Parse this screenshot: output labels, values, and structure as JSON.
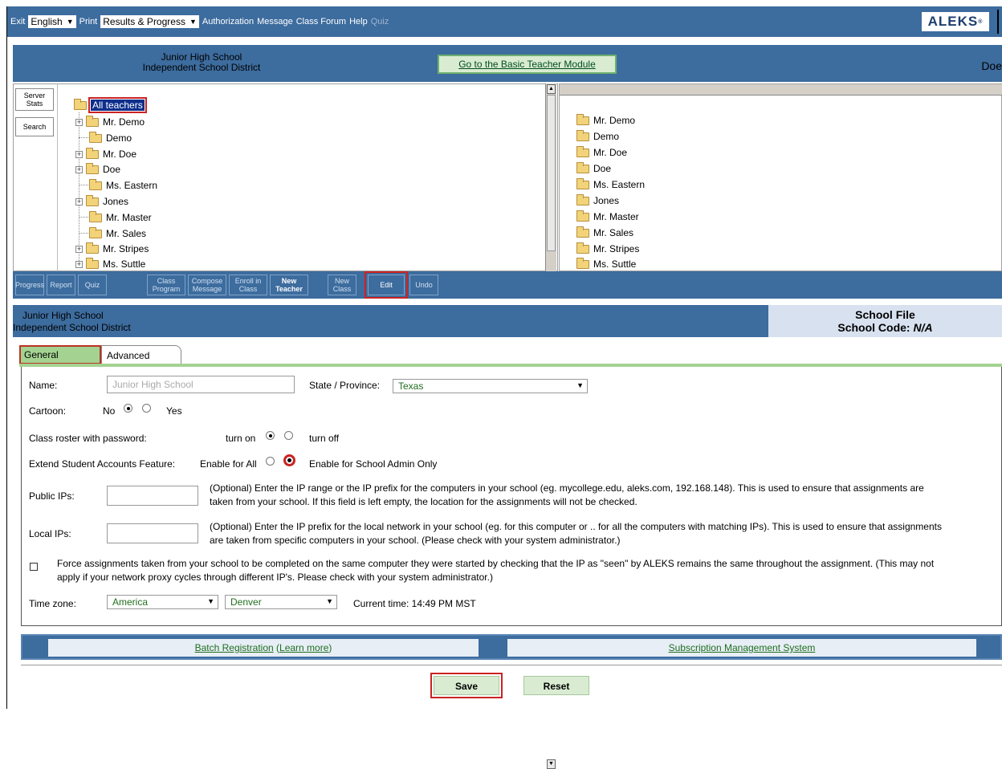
{
  "topbar": {
    "exit": "Exit",
    "language": "English",
    "print": "Print",
    "results": "Results & Progress",
    "authorization": "Authorization",
    "message": "Message",
    "forum": "Class Forum",
    "help": "Help",
    "quiz": "Quiz",
    "logo": "ALEKS"
  },
  "header": {
    "school_line1": "Junior High School",
    "school_line2": "Independent School District",
    "basic_module": "Go to the Basic Teacher Module",
    "user": "Doe"
  },
  "side": {
    "server_stats": "Server Stats",
    "search": "Search"
  },
  "tree": {
    "root": "All teachers",
    "items": [
      "Mr. Demo",
      "Demo",
      "Mr. Doe",
      "Doe",
      "Ms. Eastern",
      "Jones",
      "Mr. Master",
      "Mr. Sales",
      "Mr. Stripes",
      "Ms. Suttle"
    ]
  },
  "list": {
    "items": [
      "Mr. Demo",
      "Demo",
      "Mr. Doe",
      "Doe",
      "Ms. Eastern",
      "Jones",
      "Mr. Master",
      "Mr. Sales",
      "Mr. Stripes",
      "Ms. Suttle"
    ]
  },
  "toolbar": {
    "progress": "Progress",
    "report": "Report",
    "quiz": "Quiz",
    "class_program": "Class Program",
    "compose_message": "Compose Message",
    "enroll_in_class": "Enroll in Class",
    "new_teacher": "New Teacher",
    "new_class": "New Class",
    "edit": "Edit",
    "undo": "Undo"
  },
  "info": {
    "school_line1": "Junior High School",
    "school_line2": "Independent School District",
    "file_title": "School File",
    "school_code_label": "School Code: ",
    "school_code": "N/A"
  },
  "tabs": {
    "general": "General",
    "advanced": "Advanced"
  },
  "form": {
    "name_label": "Name:",
    "name_placeholder": "Junior High School",
    "state_label": "State / Province:",
    "state_value": "Texas",
    "cartoon_label": "Cartoon:",
    "cartoon_no": "No",
    "cartoon_yes": "Yes",
    "roster_label": "Class roster with password:",
    "roster_on": "turn on",
    "roster_off": "turn off",
    "extend_label": "Extend Student Accounts Feature:",
    "extend_all": "Enable for All",
    "extend_admin": "Enable for School Admin Only",
    "public_label": "Public IPs:",
    "public_help_1": "(Optional)  Enter the IP range or the IP prefix for the computers in your school (eg. mycollege.edu, aleks.com, 192.168.148). This is used to ensure that assignments are",
    "public_help_2": "taken from your school. If this field is left empty, the location for the assignments will not be checked.",
    "local_label": "Local IPs:",
    "local_help_1": "(Optional)  Enter the IP prefix for the local network in your school (eg.  for this computer or .. for all the computers with matching IPs). This is used to ensure that assignments",
    "local_help_2": "are taken from specific computers in your school. (Please check with your system administrator.)",
    "force_1": "Force assignments taken from your school to be completed on the same computer they were started by checking that the IP as \"seen\" by ALEKS remains the same throughout the assignment. (This may not",
    "force_2": "apply if your network proxy cycles through different IP's. Please check with your system administrator.)",
    "tz_label": "Time zone:",
    "tz_region": "America",
    "tz_city": "Denver",
    "current_time": "Current time: 14:49 PM MST"
  },
  "links": {
    "batch": "Batch Registration",
    "learn_more": "Learn more",
    "subscription": "Subscription Management System"
  },
  "buttons": {
    "save": "Save",
    "reset": "Reset"
  }
}
